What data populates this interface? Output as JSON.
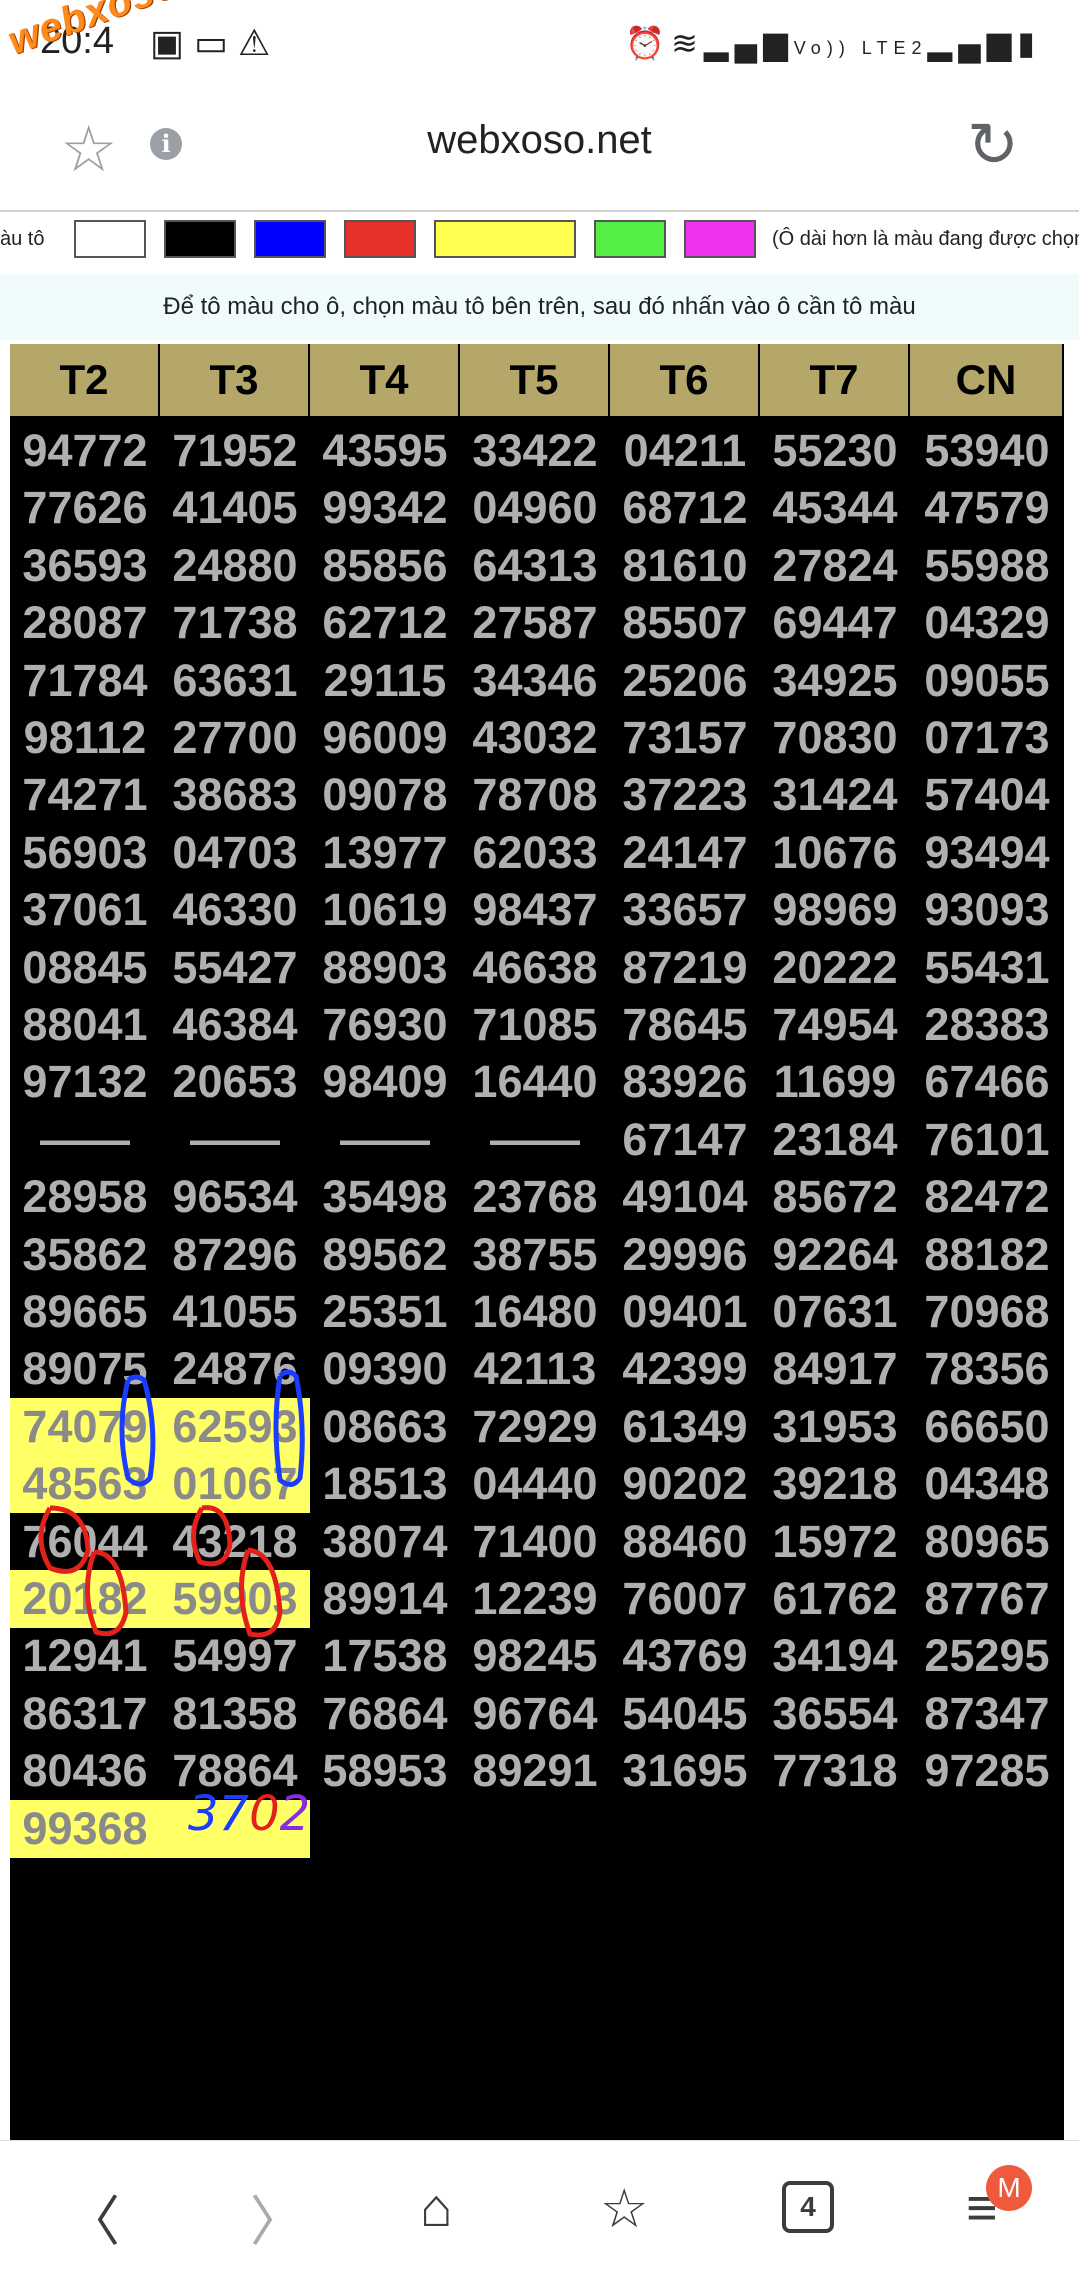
{
  "status_bar": {
    "time": "20:4",
    "left_icons": [
      "image-icon",
      "cast-icon",
      "warning-icon"
    ],
    "right_icons": [
      "alarm-icon",
      "wifi-icon",
      "signal-icon",
      "volte-icon",
      "signal-icon",
      "battery-icon"
    ],
    "volte_text": "Vo)) LTE2"
  },
  "watermark": "webxoso.net",
  "browser": {
    "url": "webxoso.net",
    "star_icon": "star-outline-icon",
    "info_icon": "info-icon",
    "reload_icon": "reload-icon"
  },
  "palette": {
    "label": "àu tô",
    "colors": [
      "#ffffff",
      "#000000",
      "#0000ff",
      "#e8302a",
      "#ffff50",
      "#55ee44",
      "#ee33ee"
    ],
    "note": "(Ô dài hơn là màu đang được chọn"
  },
  "instruction": "Để tô màu cho ô, chọn màu tô bên trên, sau đó nhấn vào ô cần tô màu",
  "table": {
    "headers": [
      "T2",
      "T3",
      "T4",
      "T5",
      "T6",
      "T7",
      "CN"
    ],
    "rows": [
      [
        "94772",
        "71952",
        "43595",
        "33422",
        "04211",
        "55230",
        "53940"
      ],
      [
        "77626",
        "41405",
        "99342",
        "04960",
        "68712",
        "45344",
        "47579"
      ],
      [
        "36593",
        "24880",
        "85856",
        "64313",
        "81610",
        "27824",
        "55988"
      ],
      [
        "28087",
        "71738",
        "62712",
        "27587",
        "85507",
        "69447",
        "04329"
      ],
      [
        "71784",
        "63631",
        "29115",
        "34346",
        "25206",
        "34925",
        "09055"
      ],
      [
        "98112",
        "27700",
        "96009",
        "43032",
        "73157",
        "70830",
        "07173"
      ],
      [
        "74271",
        "38683",
        "09078",
        "78708",
        "37223",
        "31424",
        "57404"
      ],
      [
        "56903",
        "04703",
        "13977",
        "62033",
        "24147",
        "10676",
        "93494"
      ],
      [
        "37061",
        "46330",
        "10619",
        "98437",
        "33657",
        "98969",
        "93093"
      ],
      [
        "08845",
        "55427",
        "88903",
        "46638",
        "87219",
        "20222",
        "55431"
      ],
      [
        "88041",
        "46384",
        "76930",
        "71085",
        "78645",
        "74954",
        "28383"
      ],
      [
        "97132",
        "20653",
        "98409",
        "16440",
        "83926",
        "11699",
        "67466"
      ],
      [
        "——",
        "——",
        "——",
        "——",
        "67147",
        "23184",
        "76101"
      ],
      [
        "28958",
        "96534",
        "35498",
        "23768",
        "49104",
        "85672",
        "82472"
      ],
      [
        "35862",
        "87296",
        "89562",
        "38755",
        "29996",
        "92264",
        "88182"
      ],
      [
        "89665",
        "41055",
        "25351",
        "16480",
        "09401",
        "07631",
        "70968"
      ],
      [
        "89075",
        "24876",
        "09390",
        "42113",
        "42399",
        "84917",
        "78356"
      ],
      [
        "74079",
        "62593",
        "08663",
        "72929",
        "61349",
        "31953",
        "66650"
      ],
      [
        "48563",
        "01067",
        "18513",
        "04440",
        "90202",
        "39218",
        "04348"
      ],
      [
        "76044",
        "43218",
        "38074",
        "71400",
        "88460",
        "15972",
        "80965"
      ],
      [
        "20182",
        "59903",
        "89914",
        "12239",
        "76007",
        "61762",
        "87767"
      ],
      [
        "12941",
        "54997",
        "17538",
        "98245",
        "43769",
        "34194",
        "25295"
      ],
      [
        "86317",
        "81358",
        "76864",
        "96764",
        "54045",
        "36554",
        "87347"
      ],
      [
        "80436",
        "78864",
        "58953",
        "89291",
        "31695",
        "77318",
        "97285"
      ],
      [
        "99368",
        "",
        "",
        "",
        "",
        "",
        ""
      ]
    ],
    "highlighted": [
      [
        17,
        0
      ],
      [
        17,
        1
      ],
      [
        18,
        0
      ],
      [
        18,
        1
      ],
      [
        20,
        0
      ],
      [
        20,
        1
      ],
      [
        24,
        0
      ],
      [
        24,
        1
      ]
    ],
    "highlight_color": "#ffff66",
    "handwritten": {
      "blue": "37",
      "red": "0",
      "purple": "2"
    }
  },
  "nav": {
    "back_icon": "back-icon",
    "forward_icon": "forward-icon",
    "home_icon": "home-icon",
    "bookmarks_icon": "bookmarks-icon",
    "tabs_count": "4",
    "menu_icon": "menu-icon",
    "profile_badge": "M"
  }
}
